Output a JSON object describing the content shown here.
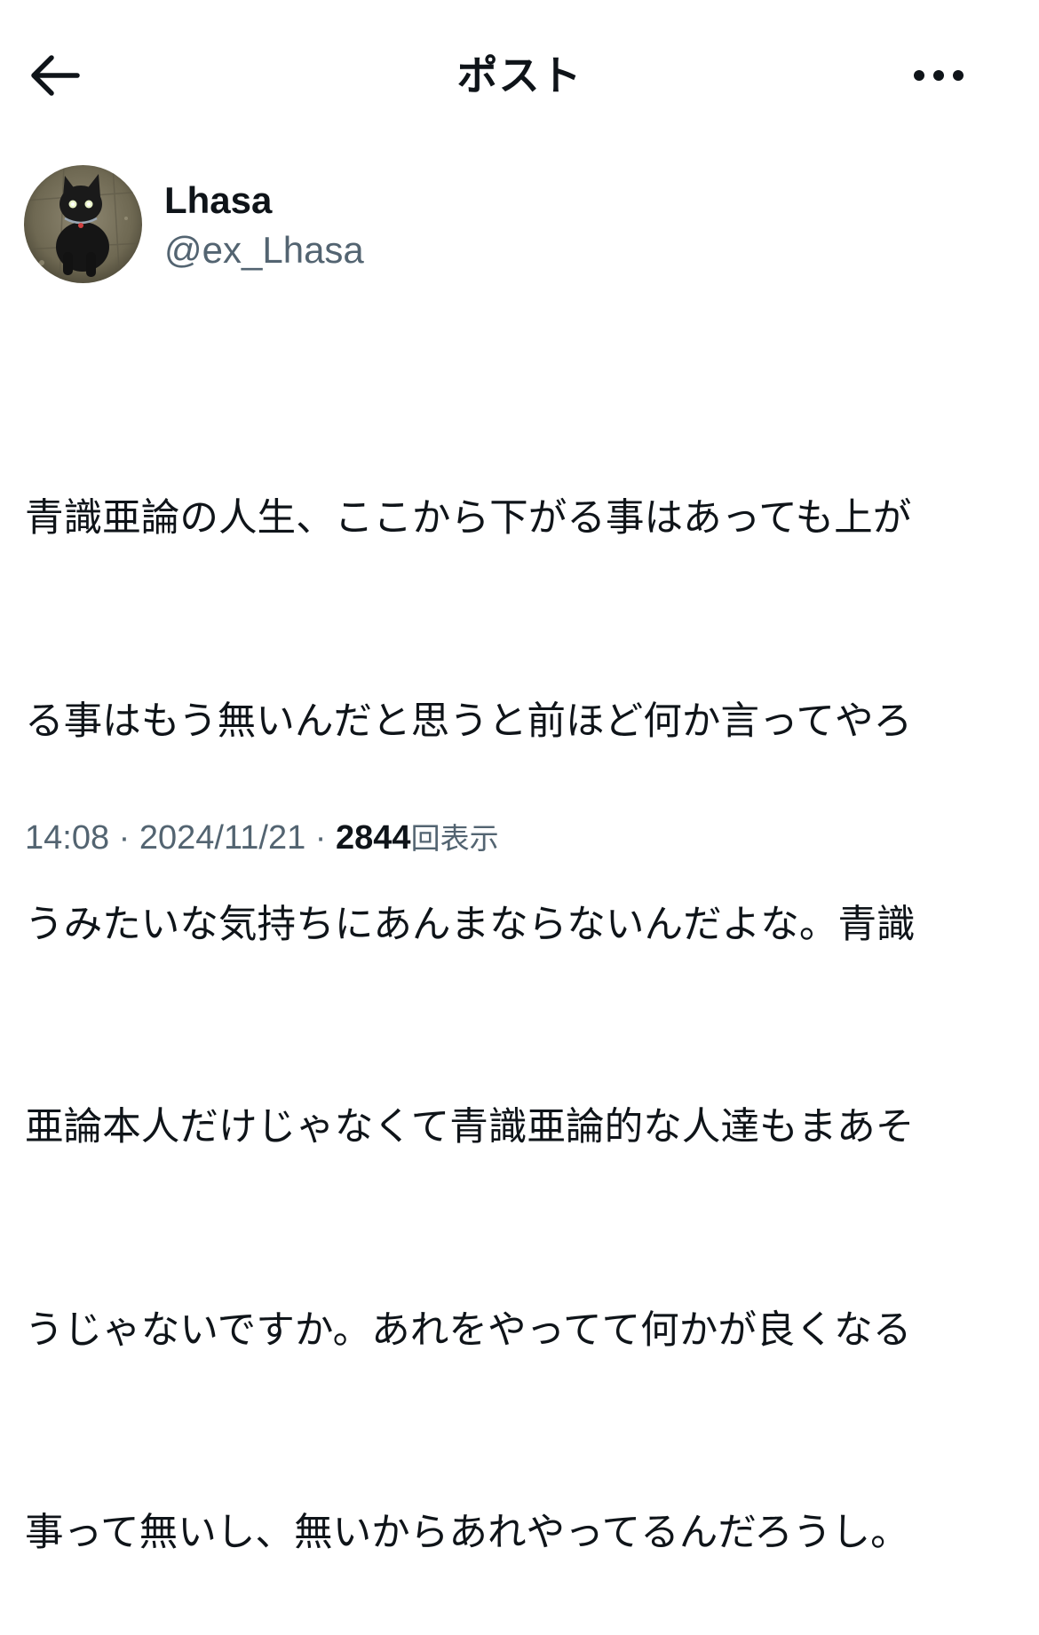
{
  "header": {
    "title": "ポスト",
    "back_icon": "arrow-left-icon",
    "more_icon": "ellipsis-horizontal-icon"
  },
  "author": {
    "display_name": "Lhasa",
    "handle": "@ex_Lhasa",
    "avatar_icon": "black-cat-photo"
  },
  "tweet": {
    "lines": [
      "青識亜論の人生、ここから下がる事はあっても上が",
      "る事はもう無いんだと思うと前ほど何か言ってやろ",
      "うみたいな気持ちにあんまならないんだよな。青識",
      "亜論本人だけじゃなくて青識亜論的な人達もまあそ",
      "うじゃないですか。あれをやってて何かが良くなる",
      "事って無いし、無いからあれやってるんだろうし。"
    ]
  },
  "meta": {
    "time": "14:08",
    "separator": " · ",
    "date": "2024/11/21",
    "separator2": " · ",
    "views_count": "2844",
    "views_label": "回表示"
  },
  "colors": {
    "text_primary": "#0f1419",
    "text_secondary": "#536471",
    "background": "#ffffff"
  }
}
